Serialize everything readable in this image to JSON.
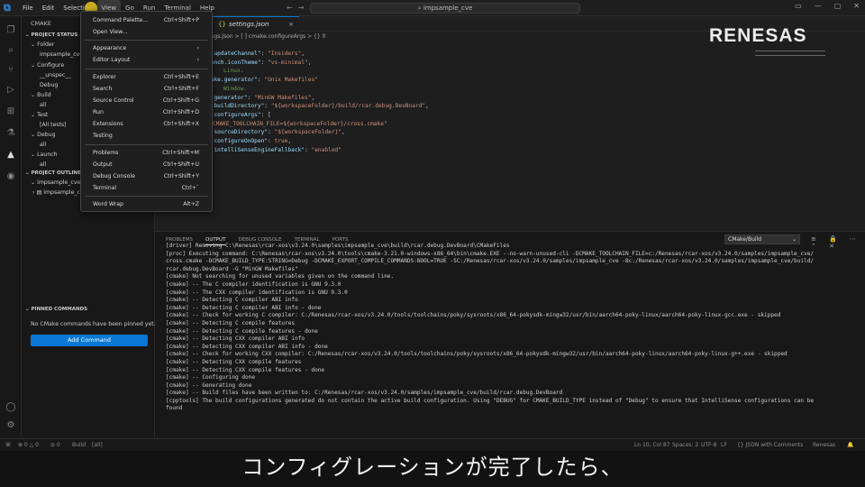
{
  "menubar": {
    "items": [
      "File",
      "Edit",
      "Selection",
      "View",
      "Go",
      "Run",
      "Terminal",
      "Help"
    ]
  },
  "command_center": {
    "text": "impsample_cve"
  },
  "sidebar": {
    "title": "CMAKE",
    "project_status": "PROJECT STATUS",
    "status_tree": [
      "Folder",
      "impsample_cve",
      "Configure",
      "__unspec__",
      "Debug",
      "Build",
      "all",
      "Test",
      "[All tests]",
      "Debug",
      "all",
      "Launch",
      "all"
    ],
    "project_outline": "PROJECT OUTLINE",
    "outline_tree": [
      "impsample_cve",
      "impsample_cve"
    ],
    "pinned_title": "PINNED COMMANDS",
    "pinned_message": "No CMake commands have been pinned yet.",
    "add_command": "Add Command"
  },
  "editor": {
    "tab": "settings.json",
    "breadcrumb": "ings.json > [ ] cmake.configureArgs > {} 0",
    "code": [
      [
        {
          "c": "k",
          "t": "p.updateChannel\""
        },
        {
          "c": "p",
          "t": ": "
        },
        {
          "c": "s",
          "t": "\"Insiders\""
        },
        {
          "c": "p",
          "t": ","
        }
      ],
      [
        {
          "c": "k",
          "t": "bench.iconTheme\""
        },
        {
          "c": "p",
          "t": ": "
        },
        {
          "c": "s",
          "t": "\"vs-minimal\""
        },
        {
          "c": "p",
          "t": ","
        }
      ],
      [
        {
          "c": "c",
          "t": "Linux."
        }
      ],
      [
        {
          "c": "k",
          "t": "make.generator\""
        },
        {
          "c": "p",
          "t": ": "
        },
        {
          "c": "s",
          "t": "\"Unix Makefiles\""
        }
      ],
      [
        {
          "c": "c",
          "t": "Window."
        }
      ],
      [
        {
          "c": "k",
          "t": "e.generator\""
        },
        {
          "c": "p",
          "t": ": "
        },
        {
          "c": "s",
          "t": "\"MinGW Makefiles\""
        },
        {
          "c": "p",
          "t": ","
        }
      ],
      [
        {
          "c": "k",
          "t": "e.buildDirectory\""
        },
        {
          "c": "p",
          "t": ": "
        },
        {
          "c": "s",
          "t": "\"${workspaceFolder}/build/rcar.debug.DevBoard\""
        },
        {
          "c": "p",
          "t": ","
        }
      ],
      [
        {
          "c": "k",
          "t": "e.configureArgs\""
        },
        {
          "c": "p",
          "t": ": ["
        }
      ],
      [
        {
          "c": "s",
          "t": "CMAKE_TOOLCHAIN_FILE=${workspaceFolder}/cross.cmake\""
        }
      ],
      [
        {
          "c": "p",
          "t": ""
        }
      ],
      [
        {
          "c": "k",
          "t": "e.sourceDirectory\""
        },
        {
          "c": "p",
          "t": ": "
        },
        {
          "c": "s",
          "t": "\"${workspaceFolder}\""
        },
        {
          "c": "p",
          "t": ","
        }
      ],
      [
        {
          "c": "k",
          "t": "e.configureOnOpen\""
        },
        {
          "c": "p",
          "t": ": "
        },
        {
          "c": "s",
          "t": "true"
        },
        {
          "c": "p",
          "t": ","
        }
      ],
      [
        {
          "c": "k",
          "t": "p.intelliSenseEngineFallback\""
        },
        {
          "c": "p",
          "t": ": "
        },
        {
          "c": "s",
          "t": "\"enabled\""
        }
      ]
    ]
  },
  "brand": {
    "logo": "RENESAS"
  },
  "panel": {
    "tabs": [
      "PROBLEMS",
      "OUTPUT",
      "DEBUG CONSOLE",
      "TERMINAL",
      "PORTS"
    ],
    "selected_channel": "CMake/Build",
    "output_lines": [
      "[driver] Removing C:\\Renesas\\rcar-xos\\v3.24.0\\samples\\impsample_cve\\build\\rcar.debug.DevBoard\\CMakeFiles",
      "[proc] Executing command: C:\\Renesas\\rcar-xos\\v3.24.0\\tools\\cmake-3.21.0-windows-x86_64\\bin\\cmake.EXE --no-warn-unused-cli -DCMAKE_TOOLCHAIN_FILE=c:/Renesas/rcar-xos/v3.24.0/samples/impsample_cve/",
      "cross.cmake -DCMAKE_BUILD_TYPE:STRING=Debug -DCMAKE_EXPORT_COMPILE_COMMANDS:BOOL=TRUE -SC:/Renesas/rcar-xos/v3.24.0/samples/impsample_cve -Bc:/Renesas/rcar-xos/v3.24.0/samples/impsample_cve/build/",
      "rcar.debug.DevBoard -G \"MinGW Makefiles\"",
      "[cmake] Not searching for unused variables given on the command line.",
      "[cmake] -- The C compiler identification is GNU 9.3.0",
      "[cmake] -- The CXX compiler identification is GNU 9.3.0",
      "[cmake] -- Detecting C compiler ABI info",
      "[cmake] -- Detecting C compiler ABI info - done",
      "[cmake] -- Check for working C compiler: C:/Renesas/rcar-xos/v3.24.0/tools/toolchains/poky/sysroots/x86_64-pokysdk-mingw32/usr/bin/aarch64-poky-linux/aarch64-poky-linux-gcc.exe - skipped",
      "[cmake] -- Detecting C compile features",
      "[cmake] -- Detecting C compile features - done",
      "[cmake] -- Detecting CXX compiler ABI info",
      "[cmake] -- Detecting CXX compiler ABI info - done",
      "[cmake] -- Check for working CXX compiler: C:/Renesas/rcar-xos/v3.24.0/tools/toolchains/poky/sysroots/x86_64-pokysdk-mingw32/usr/bin/aarch64-poky-linux/aarch64-poky-linux-g++.exe - skipped",
      "[cmake] -- Detecting CXX compile features",
      "[cmake] -- Detecting CXX compile features - done",
      "[cmake] -- Configuring done",
      "[cmake] -- Generating done",
      "[cmake] -- Build files have been written to: C:/Renesas/rcar-xos/v3.24.0/samples/impsample_cve/build/rcar.debug.DevBoard",
      "[cpptools] The build configurations generated do not contain the active build configuration. Using \"DEBUG\" for CMAKE_BUILD_TYPE instead of \"Debug\" to ensure that IntelliSense configurations can be",
      "found"
    ]
  },
  "statusbar": {
    "left": [
      "⊗ 0 △ 0",
      "⊘ 0",
      "Build",
      "[all]"
    ],
    "right": [
      "Ln 10, Col 87",
      "Spaces: 2",
      "UTF-8",
      "LF",
      "{} JSON with Comments",
      "Renesas"
    ]
  },
  "subtitle": "コンフィグレーションが完了したら、",
  "view_menu": {
    "items": [
      {
        "label": "Command Palette...",
        "key": "Ctrl+Shift+P"
      },
      {
        "label": "Open View...",
        "key": ""
      },
      {
        "label": "Appearance",
        "key": "›"
      },
      {
        "label": "Editor Layout",
        "key": "›"
      },
      {
        "label": "Explorer",
        "key": "Ctrl+Shift+E"
      },
      {
        "label": "Search",
        "key": "Ctrl+Shift+F"
      },
      {
        "label": "Source Control",
        "key": "Ctrl+Shift+G"
      },
      {
        "label": "Run",
        "key": "Ctrl+Shift+D"
      },
      {
        "label": "Extensions",
        "key": "Ctrl+Shift+X"
      },
      {
        "label": "Testing",
        "key": ""
      },
      {
        "label": "Problems",
        "key": "Ctrl+Shift+M"
      },
      {
        "label": "Output",
        "key": "Ctrl+Shift+U"
      },
      {
        "label": "Debug Console",
        "key": "Ctrl+Shift+Y"
      },
      {
        "label": "Terminal",
        "key": "Ctrl+`"
      },
      {
        "label": "Word Wrap",
        "key": "Alt+Z"
      }
    ]
  },
  "colors": {
    "accent": "#0a78d4",
    "key": "#9cdcfe",
    "string": "#ce9178",
    "comment": "#6a9955"
  }
}
